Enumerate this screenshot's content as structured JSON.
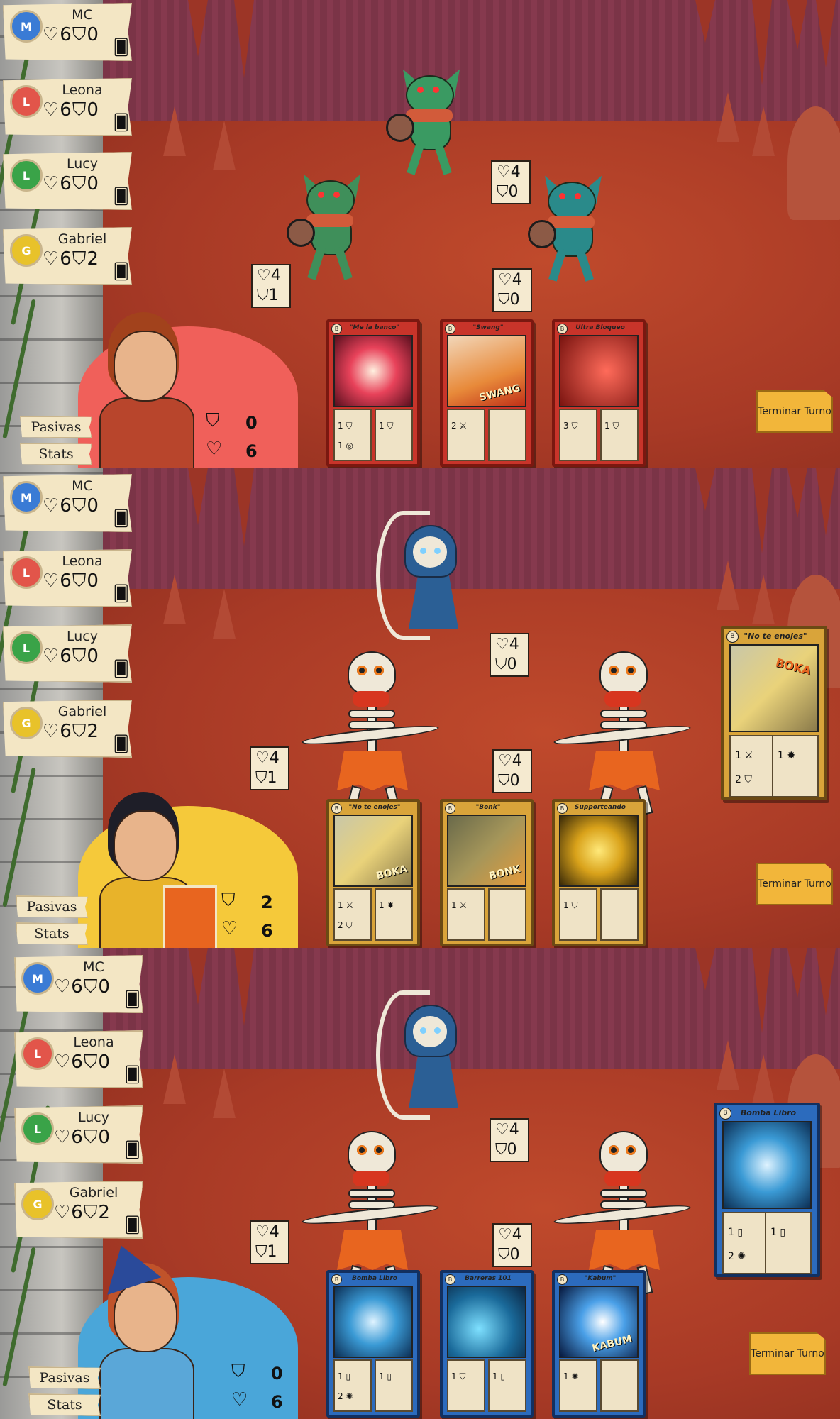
{
  "party": [
    {
      "name": "MC",
      "hp": "6",
      "shield": "0",
      "avatar_color": "#3a7bd5"
    },
    {
      "name": "Leona",
      "hp": "6",
      "shield": "0",
      "avatar_color": "#e2554a"
    },
    {
      "name": "Lucy",
      "hp": "6",
      "shield": "0",
      "avatar_color": "#3aa348"
    },
    {
      "name": "Gabriel",
      "hp": "6",
      "shield": "2",
      "avatar_color": "#e8c22a"
    }
  ],
  "icons": {
    "heart": "♡",
    "shield": "⛉",
    "deck": "🂠"
  },
  "labels": {
    "pasivas": "Pasivas",
    "stats": "Stats",
    "end_turn": "Terminar Turno"
  },
  "scenes": [
    {
      "hero": "Leona",
      "hero_color": "#f0605a",
      "hero_shield": "0",
      "hero_hp": "6",
      "enemies": [
        {
          "kind": "goblin",
          "hp": "4",
          "shield": "0"
        },
        {
          "kind": "goblin",
          "hp": "4",
          "shield": "1"
        },
        {
          "kind": "goblin",
          "hp": "4",
          "shield": "0"
        }
      ],
      "cards": [
        {
          "title": "\"Me la banco\"",
          "color": "red",
          "left": [
            "1 ⛉",
            "1 ◎"
          ],
          "right": [
            "1 ⛉"
          ]
        },
        {
          "title": "\"Swang\"",
          "color": "red",
          "art_text": "SWANG",
          "left": [
            "2 ⚔"
          ],
          "right": []
        },
        {
          "title": "Ultra Bloqueo",
          "color": "red",
          "left": [
            "3 ⛉"
          ],
          "right": [
            "1 ⛉"
          ]
        }
      ]
    },
    {
      "hero": "Gabriel",
      "hero_color": "#f5c93a",
      "hero_shield": "2",
      "hero_hp": "6",
      "enemies": [
        {
          "kind": "archer",
          "hp": "4",
          "shield": "0"
        },
        {
          "kind": "skeleton",
          "hp": "4",
          "shield": "1"
        },
        {
          "kind": "skeleton",
          "hp": "4",
          "shield": "0"
        }
      ],
      "cards": [
        {
          "title": "\"No te enojes\"",
          "color": "gold",
          "art_text": "BOKA",
          "left": [
            "1 ⚔",
            "2 ⛉"
          ],
          "right": [
            "1 ✸"
          ]
        },
        {
          "title": "\"Bonk\"",
          "color": "gold",
          "art_text": "BONK",
          "left": [
            "1 ⚔"
          ],
          "right": []
        },
        {
          "title": "Supporteando",
          "color": "gold",
          "left": [
            "1 ⛉"
          ],
          "right": []
        }
      ],
      "selected": {
        "title": "\"No te enojes\"",
        "color": "gold",
        "art_text": "BOKA",
        "left": [
          "1 ⚔",
          "2 ⛉"
        ],
        "right": [
          "1 ✸"
        ]
      }
    },
    {
      "hero": "Lucy",
      "hero_color": "#4aa6d9",
      "hero_shield": "0",
      "hero_hp": "6",
      "enemies": [
        {
          "kind": "archer",
          "hp": "4",
          "shield": "0"
        },
        {
          "kind": "skeleton",
          "hp": "4",
          "shield": "1"
        },
        {
          "kind": "skeleton",
          "hp": "4",
          "shield": "0"
        }
      ],
      "cards": [
        {
          "title": "Bomba Libro",
          "color": "blue",
          "left": [
            "1 ▯",
            "2 ✺"
          ],
          "right": [
            "1 ▯"
          ]
        },
        {
          "title": "Barreras 101",
          "color": "blue",
          "left": [
            "1 ⛉"
          ],
          "right": [
            "1 ▯"
          ]
        },
        {
          "title": "\"Kabum\"",
          "color": "blue",
          "art_text": "KABUM",
          "left": [
            "1 ✺"
          ],
          "right": []
        }
      ],
      "selected": {
        "title": "Bomba Libro",
        "color": "blue",
        "left": [
          "1 ▯",
          "2 ✺"
        ],
        "right": [
          "1 ▯"
        ]
      }
    }
  ]
}
